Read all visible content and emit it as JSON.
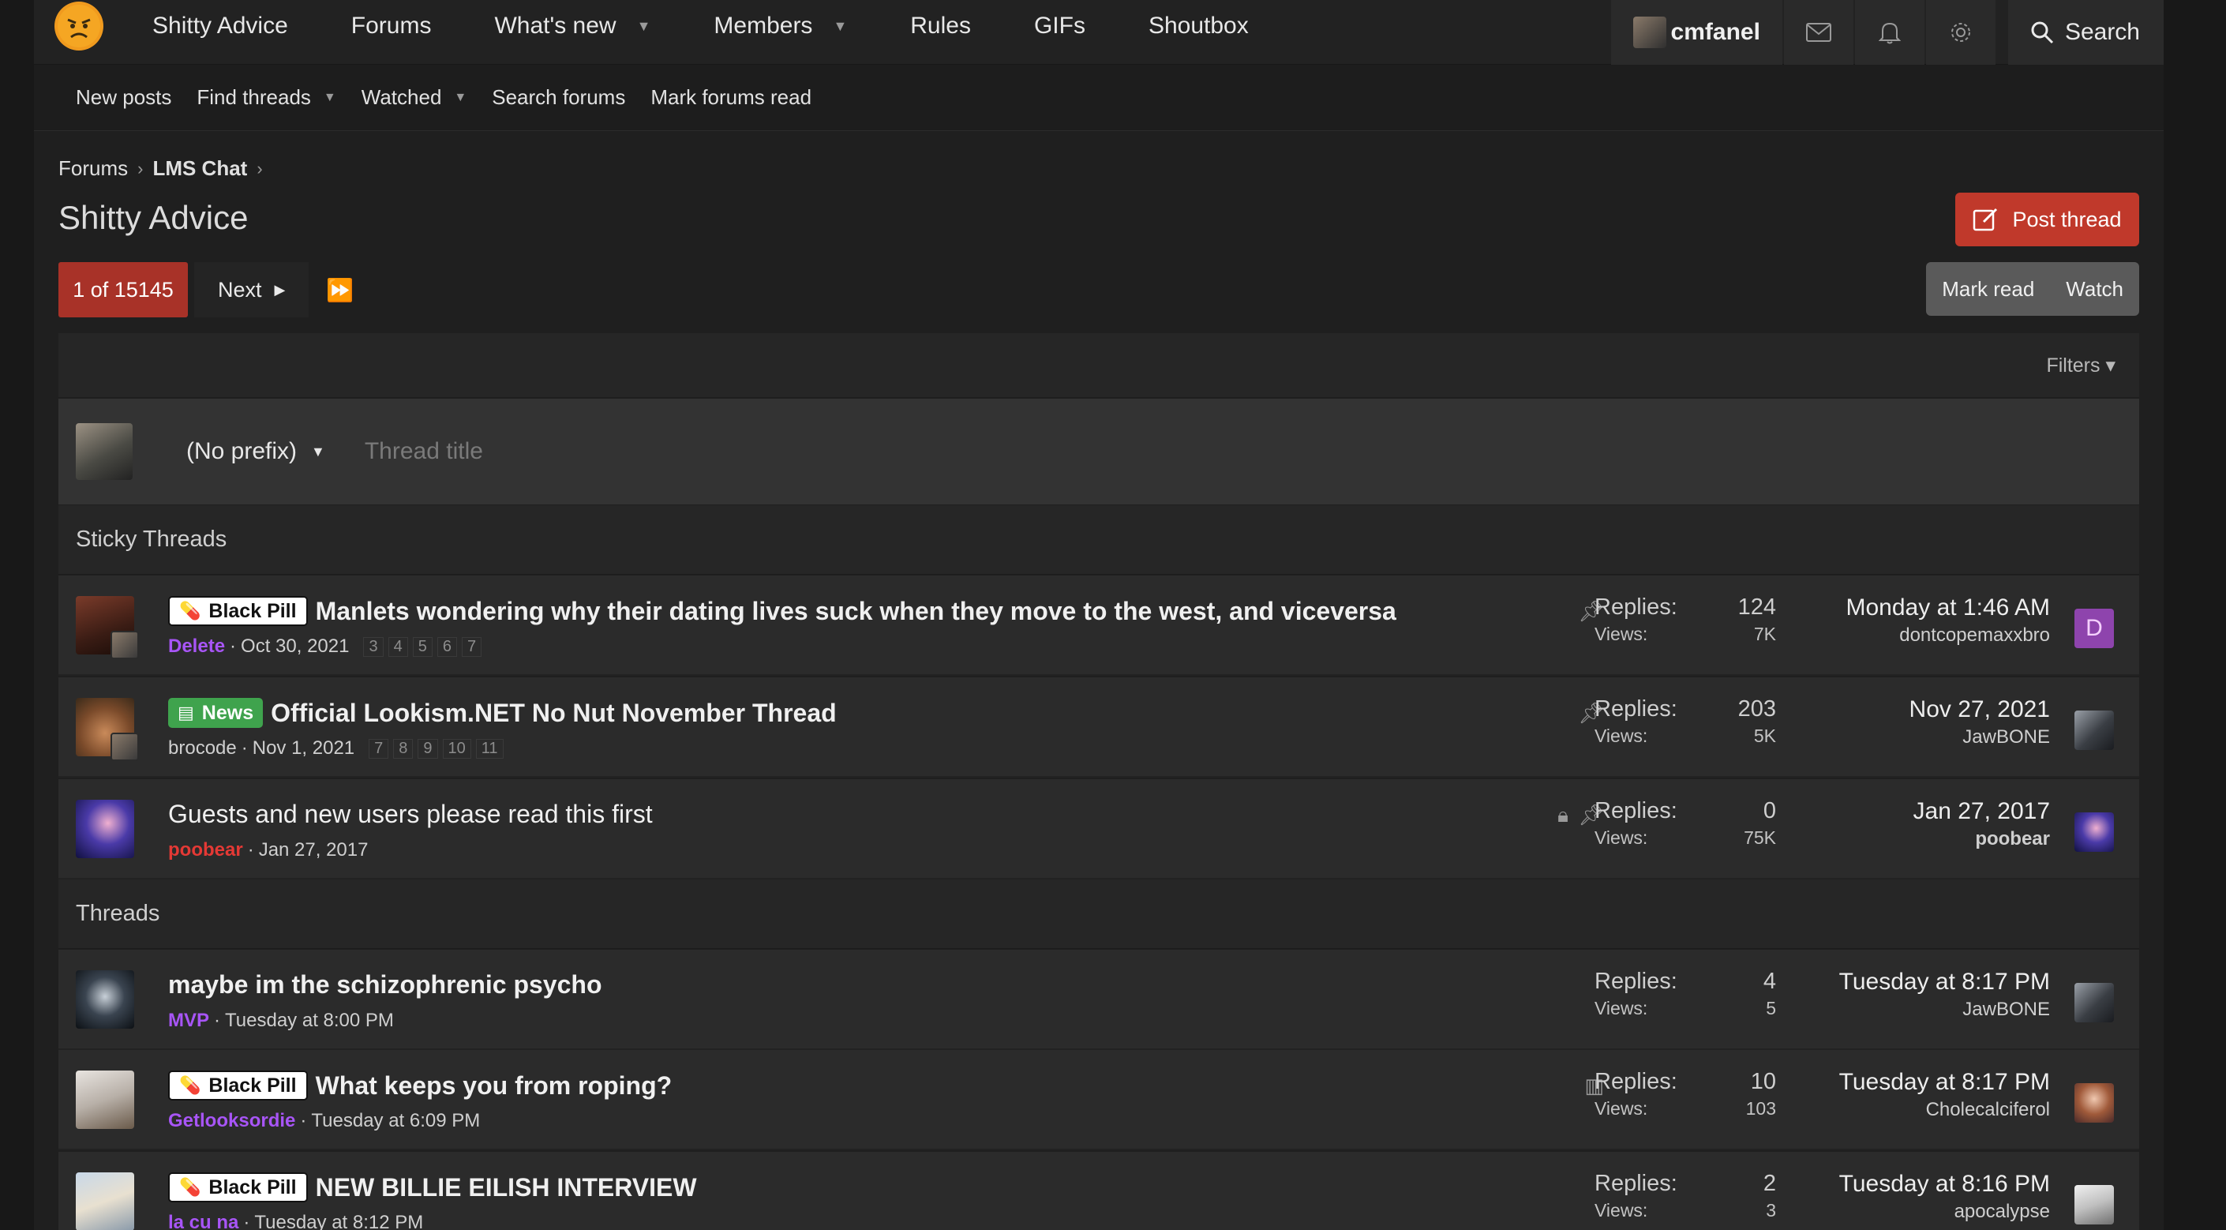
{
  "nav": {
    "brand": "Shitty Advice",
    "items": [
      "Forums",
      "What's new",
      "Members",
      "Rules",
      "GIFs",
      "Shoutbox"
    ],
    "username": "cmfanel",
    "search_label": "Search"
  },
  "subnav": {
    "items": [
      "New posts",
      "Find threads",
      "Watched",
      "Search forums",
      "Mark forums read"
    ]
  },
  "breadcrumb": [
    "Forums",
    "LMS Chat"
  ],
  "page_title": "Shitty Advice",
  "buttons": {
    "post_thread": "Post thread",
    "mark_read": "Mark read",
    "watch": "Watch",
    "filters": "Filters"
  },
  "pagination": {
    "current": "1 of 15145",
    "next": "Next"
  },
  "quick_thread": {
    "prefix": "(No prefix)",
    "placeholder": "Thread title"
  },
  "sections": {
    "sticky": "Sticky Threads",
    "threads": "Threads"
  },
  "threads": [
    {
      "prefix": "Black Pill",
      "title": "Manlets wondering why their dating lives suck when they move to the west, and viceversa",
      "author": "Delete",
      "date": "Oct 30, 2021",
      "pages": [
        "3",
        "4",
        "5",
        "6",
        "7"
      ],
      "replies_label": "Replies:",
      "replies": "124",
      "views_label": "Views:",
      "views": "7K",
      "last_date": "Monday at 1:46 AM",
      "last_user": "dontcopemaxxbro",
      "last_letter": "D"
    },
    {
      "prefix": "News",
      "title": "Official Lookism.NET No Nut November Thread",
      "author": "brocode",
      "date": "Nov 1, 2021",
      "pages": [
        "7",
        "8",
        "9",
        "10",
        "11"
      ],
      "replies_label": "Replies:",
      "replies": "203",
      "views_label": "Views:",
      "views": "5K",
      "last_date": "Nov 27, 2021",
      "last_user": "JawBONE"
    },
    {
      "title": "Guests and new users please read this first",
      "author": "poobear",
      "date": "Jan 27, 2017",
      "replies_label": "Replies:",
      "replies": "0",
      "views_label": "Views:",
      "views": "75K",
      "last_date": "Jan 27, 2017",
      "last_user": "poobear"
    },
    {
      "title": "maybe im the schizophrenic psycho",
      "author": "MVP",
      "date": "Tuesday at 8:00 PM",
      "replies_label": "Replies:",
      "replies": "4",
      "views_label": "Views:",
      "views": "5",
      "last_date": "Tuesday at 8:17 PM",
      "last_user": "JawBONE"
    },
    {
      "prefix": "Black Pill",
      "title": "What keeps you from roping?",
      "author": "Getlooksordie",
      "date": "Tuesday at 6:09 PM",
      "replies_label": "Replies:",
      "replies": "10",
      "views_label": "Views:",
      "views": "103",
      "last_date": "Tuesday at 8:17 PM",
      "last_user": "Cholecalciferol"
    },
    {
      "prefix": "Black Pill",
      "title": "NEW BILLIE EILISH INTERVIEW",
      "author": "la cu na",
      "date": "Tuesday at 8:12 PM",
      "replies_label": "Replies:",
      "replies": "2",
      "views_label": "Views:",
      "views": "3",
      "last_date": "Tuesday at 8:16 PM",
      "last_user": "apocalypse"
    }
  ],
  "colors": {
    "accent_red": "#c0392b",
    "user_purple": "#a855f7",
    "user_red": "#e53935",
    "user_teal": "#38b2ac",
    "news_green": "#3fa34d"
  }
}
